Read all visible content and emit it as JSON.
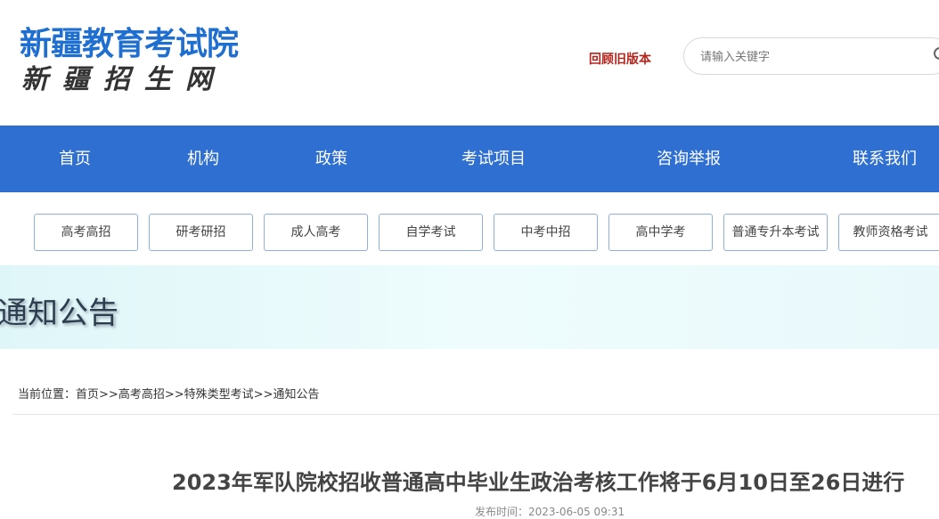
{
  "header": {
    "logo_title": "新疆教育考试院",
    "logo_subtitle": "新疆招生网",
    "old_version_link": "回顾旧版本",
    "search": {
      "placeholder": "请输入关键字",
      "value": ""
    }
  },
  "nav": {
    "items": [
      {
        "label": "首页"
      },
      {
        "label": "机构"
      },
      {
        "label": "政策"
      },
      {
        "label": "考试项目"
      },
      {
        "label": "咨询举报"
      },
      {
        "label": "联系我们"
      }
    ]
  },
  "categories": [
    {
      "label": "高考高招"
    },
    {
      "label": "研考研招"
    },
    {
      "label": "成人高考"
    },
    {
      "label": "自学考试"
    },
    {
      "label": "中考中招"
    },
    {
      "label": "高中学考"
    },
    {
      "label": "普通专升本考试"
    },
    {
      "label": "教师资格考试"
    }
  ],
  "banner": {
    "title": "通知公告"
  },
  "breadcrumb": {
    "prefix": "当前位置：",
    "items": [
      "首页",
      "高考高招",
      "特殊类型考试",
      "通知公告"
    ],
    "separator": ">>"
  },
  "article": {
    "title": "2023年军队院校招收普通高中毕业生政治考核工作将于6月10日至26日进行",
    "publish_time": "发布时间：2023-06-05 09:31"
  }
}
